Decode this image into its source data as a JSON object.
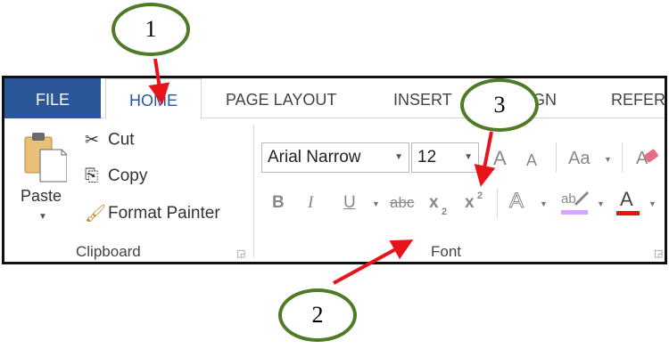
{
  "tabs": {
    "file": "FILE",
    "home": "HOME",
    "page_layout": "PAGE LAYOUT",
    "insert": "INSERT",
    "design_partial": "GN",
    "references_partial": "REFERE"
  },
  "clipboard": {
    "paste_label": "Paste",
    "cut_label": "Cut",
    "copy_label": "Copy",
    "format_painter_label": "Format Painter",
    "group_label": "Clipboard"
  },
  "font": {
    "font_name": "Arial Narrow",
    "font_size": "12",
    "grow_font": "A",
    "shrink_font": "A",
    "change_case": "Aa",
    "bold": "B",
    "italic": "I",
    "underline": "U",
    "strikethrough": "abc",
    "subscript": "x",
    "subscript_mark": "2",
    "superscript": "x",
    "superscript_mark": "2",
    "text_effects": "A",
    "highlight": "ab",
    "font_color": "A",
    "group_label": "Font"
  },
  "callouts": [
    "1",
    "2",
    "3"
  ],
  "colors": {
    "file_tab": "#2b579a",
    "callout_border": "#4f7a26",
    "arrow": "#e8141b",
    "font_color_bar": "#e8141b",
    "highlight_bar": "#d8a4ff"
  }
}
